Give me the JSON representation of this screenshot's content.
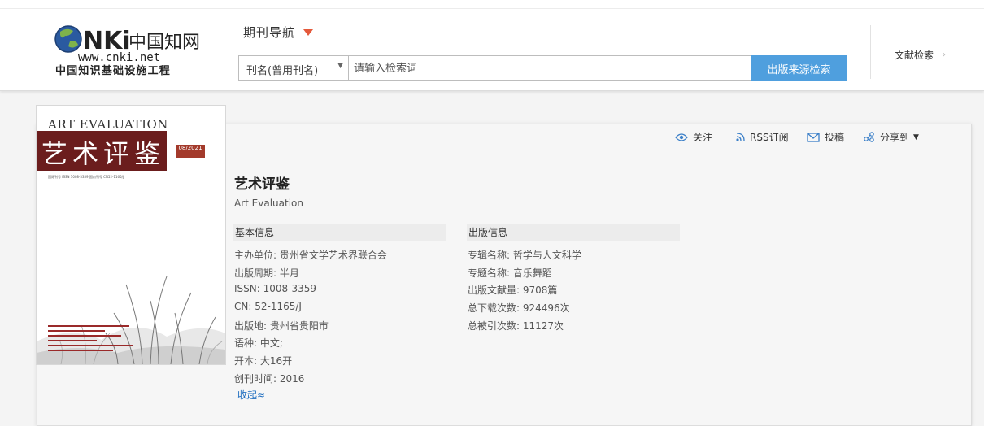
{
  "header": {
    "logo_text": "CNKi中国知网",
    "logo_url": "www.cnki.net",
    "logo_tagline": "中国知识基础设施工程",
    "nav_label": "期刊导航",
    "search_field_value": "刊名(曾用刊名)",
    "search_placeholder": "请输入检索词",
    "search_button": "出版来源检索",
    "right_link": "文献检索"
  },
  "actions": {
    "follow": "关注",
    "rss": "RSS订阅",
    "submit": "投稿",
    "share": "分享到"
  },
  "journal": {
    "title_cn": "艺术评鉴",
    "title_en": "Art Evaluation",
    "cover_en": "ART EVALUATION",
    "cover_cn": "艺术评鉴",
    "cover_issue": "08/2021",
    "cover_issn_line": "国际刊号 ISSN 1008-3359    国内刊号 CN52-1165/J"
  },
  "basic": {
    "heading": "基本信息",
    "rows": [
      {
        "label": "主办单位:",
        "value": "贵州省文学艺术界联合会"
      },
      {
        "label": "出版周期:",
        "value": "半月"
      },
      {
        "label": "ISSN:",
        "value": "1008-3359"
      },
      {
        "label": "CN:",
        "value": "52-1165/J"
      },
      {
        "label": "出版地:",
        "value": "贵州省贵阳市"
      },
      {
        "label": "语种:",
        "value": "中文;"
      },
      {
        "label": "开本:",
        "value": "大16开"
      },
      {
        "label": "创刊时间:",
        "value": "2016"
      }
    ],
    "collapse": "收起≈"
  },
  "publish": {
    "heading": "出版信息",
    "rows": [
      {
        "label": "专辑名称:",
        "value": "哲学与人文科学"
      },
      {
        "label": "专题名称:",
        "value": "音乐舞蹈"
      },
      {
        "label": "出版文献量:",
        "value": "9708篇"
      },
      {
        "label": "总下载次数:",
        "value": "924496次"
      },
      {
        "label": "总被引次数:",
        "value": "11127次"
      }
    ]
  },
  "colors": {
    "accent": "#4f9fde",
    "caret": "#e4593b",
    "link": "#1e6dbf",
    "cover_band": "#6b1d1d"
  }
}
